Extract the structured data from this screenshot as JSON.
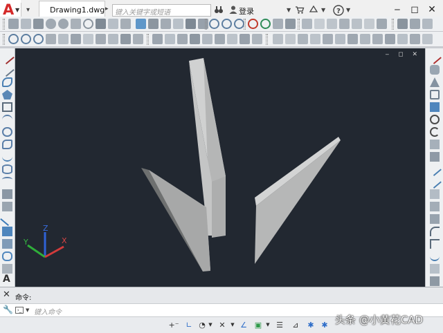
{
  "app": {
    "logo_letter": "A",
    "document_tab": "Drawing1.dwg",
    "search_placeholder": "键入关键字或短语",
    "login_label": "登录"
  },
  "viewport": {
    "background": "#222831",
    "ucs": {
      "x_label": "X",
      "y_label": "Y",
      "z_label": "Z"
    },
    "controls": "‒ ◻ ✕"
  },
  "command": {
    "history_label": "命令:",
    "input_placeholder": "键入命令"
  },
  "watermark": "头条 @小黄花CAD",
  "icons": {
    "close": "close-icon",
    "wrench": "wrench-icon",
    "binoculars": "binoculars-icon",
    "user": "user-icon",
    "cart": "cart-icon",
    "help": "help-icon"
  }
}
